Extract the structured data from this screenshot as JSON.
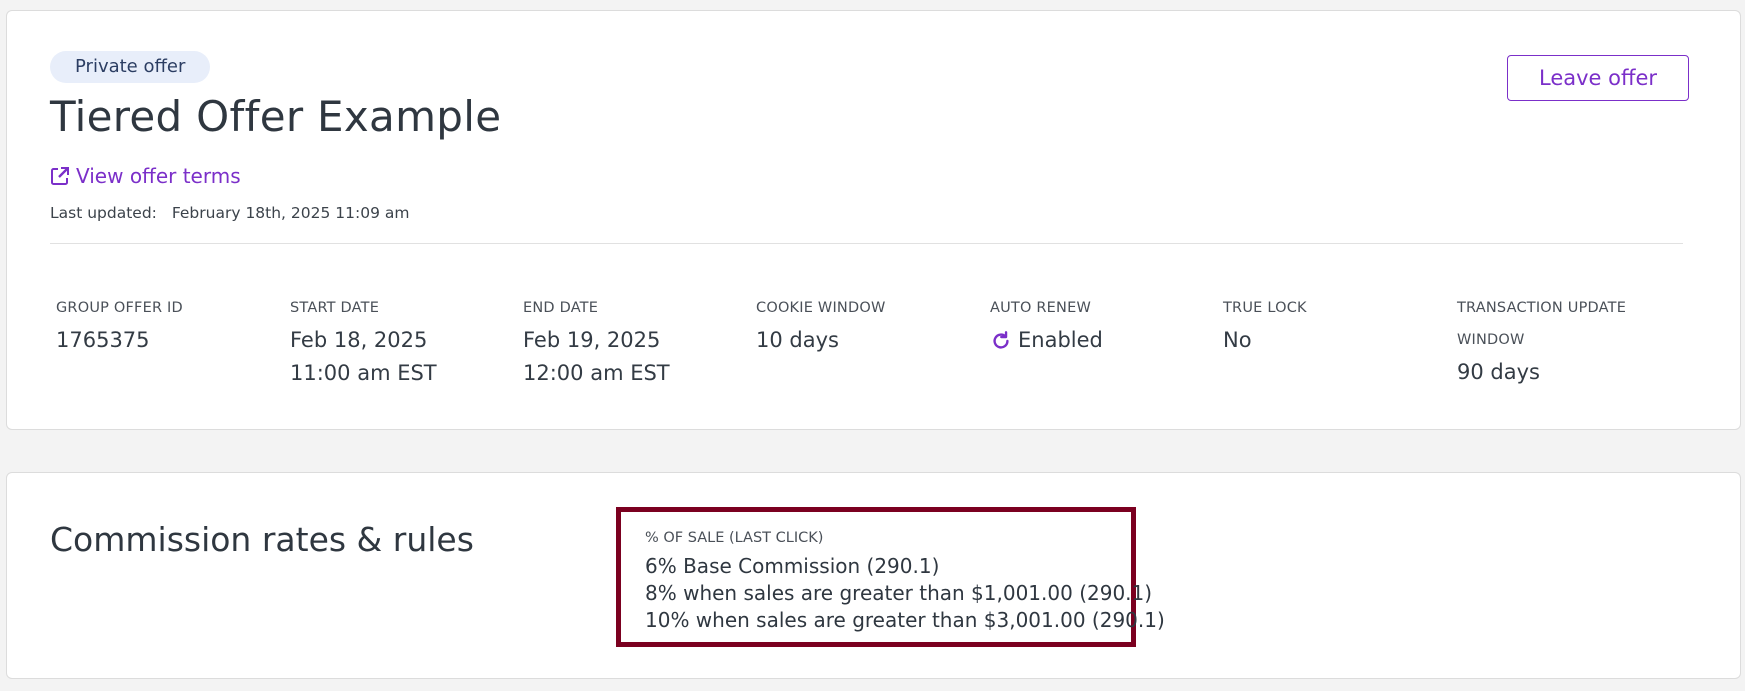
{
  "offer": {
    "badge": "Private offer",
    "title": "Tiered Offer Example",
    "leave_label": "Leave offer",
    "terms_link": "View offer terms",
    "last_updated_label": "Last updated:",
    "last_updated_value": "February 18th, 2025 11:09 am"
  },
  "stats": {
    "group_offer_id": {
      "label": "GROUP OFFER ID",
      "value": "1765375"
    },
    "start_date": {
      "label": "START DATE",
      "value": "Feb 18, 2025\n11:00 am EST"
    },
    "end_date": {
      "label": "END DATE",
      "value": "Feb 19, 2025\n12:00 am EST"
    },
    "cookie_window": {
      "label": "COOKIE WINDOW",
      "value": "10 days"
    },
    "auto_renew": {
      "label": "AUTO RENEW",
      "value": "Enabled"
    },
    "true_lock": {
      "label": "TRUE LOCK",
      "value": "No"
    },
    "transaction_window": {
      "label": "TRANSACTION UPDATE WINDOW",
      "value": "90 days"
    }
  },
  "commission": {
    "title": "Commission rates & rules",
    "rate_type": "% OF SALE (LAST CLICK)",
    "rates": [
      "6% Base Commission (290.1)",
      "8% when sales are greater than $1,001.00 (290.1)",
      "10% when sales are greater than $3,001.00 (290.1)"
    ]
  },
  "icons": {
    "external_link": "external-link-icon",
    "auto_renew": "refresh-icon"
  },
  "colors": {
    "accent": "#7b2fc9",
    "badge_bg": "#e8eefa",
    "highlight_border": "#7b0020",
    "page_bg": "#f3f3f3"
  }
}
